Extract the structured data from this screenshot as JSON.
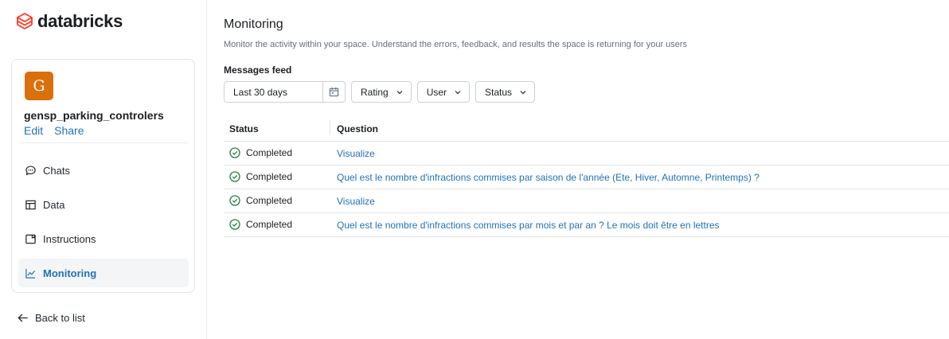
{
  "brand": {
    "name": "databricks",
    "color": "#ff3621"
  },
  "space": {
    "avatar_letter": "G",
    "avatar_color": "#d9700b",
    "name": "gensp_parking_controlers",
    "edit_label": "Edit",
    "share_label": "Share"
  },
  "nav": {
    "items": [
      {
        "label": "Chats",
        "icon": "chat-bubble-icon"
      },
      {
        "label": "Data",
        "icon": "table-icon"
      },
      {
        "label": "Instructions",
        "icon": "book-icon"
      },
      {
        "label": "Monitoring",
        "icon": "line-chart-icon",
        "active": true
      }
    ],
    "back_label": "Back to list"
  },
  "main": {
    "title": "Monitoring",
    "subtitle": "Monitor the activity within your space. Understand the errors, feedback, and results the space is returning for your users",
    "feed_label": "Messages feed",
    "filters": {
      "date_range": "Last 30 days",
      "rating": "Rating",
      "user": "User",
      "status": "Status"
    },
    "table": {
      "headers": {
        "status": "Status",
        "question": "Question"
      },
      "rows": [
        {
          "status": "Completed",
          "question": "Visualize"
        },
        {
          "status": "Completed",
          "question": "Quel est le nombre d'infractions commises par saison de l'année (Ete, Hiver, Automne, Printemps) ?"
        },
        {
          "status": "Completed",
          "question": "Visualize"
        },
        {
          "status": "Completed",
          "question": "Quel est le nombre d'infractions commises par mois et par an ? Le mois doit être en lettres"
        }
      ]
    }
  },
  "colors": {
    "link": "#2272b4",
    "success": "#277c43"
  }
}
